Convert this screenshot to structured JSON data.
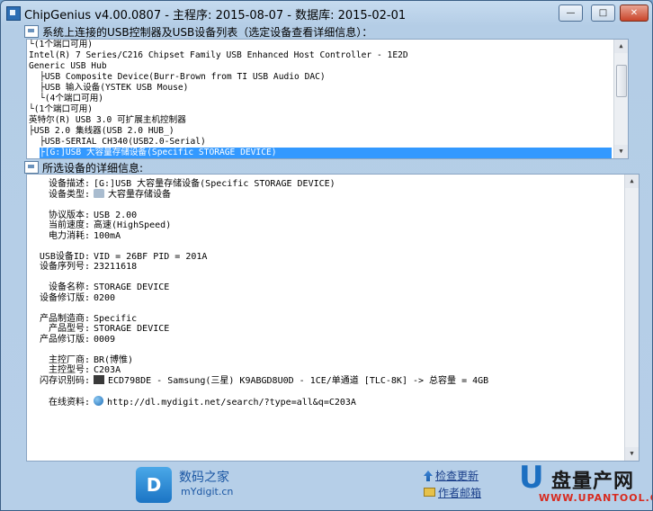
{
  "window": {
    "title": "ChipGenius v4.00.0807 - 主程序: 2015-08-07 - 数据库: 2015-02-01",
    "min": "—",
    "max": "□",
    "close": "✕"
  },
  "device_list": {
    "label": "系统上连接的USB控制器及USB设备列表（选定设备查看详细信息）：",
    "items": [
      {
        "text": "└(1个端口可用)",
        "indent": 0,
        "selected": false
      },
      {
        "text": "Intel(R) 7 Series/C216 Chipset Family USB Enhanced Host Controller - 1E2D",
        "indent": 0,
        "selected": false
      },
      {
        "text": "  Generic USB Hub",
        "indent": 0,
        "selected": false
      },
      {
        "text": "├USB Composite Device(Burr-Brown from TI USB Audio DAC)",
        "indent": 2,
        "selected": false
      },
      {
        "text": "├USB 输入设备(YSTEK USB Mouse)",
        "indent": 2,
        "selected": false
      },
      {
        "text": "└(4个端口可用)",
        "indent": 2,
        "selected": false
      },
      {
        "text": "└(1个端口可用)",
        "indent": 0,
        "selected": false
      },
      {
        "text": "英特尔(R) USB 3.0 可扩展主机控制器",
        "indent": 0,
        "selected": false
      },
      {
        "text": "├USB 2.0 集线器(USB 2.0 HUB_)",
        "indent": 0,
        "selected": false
      },
      {
        "text": "├USB-SERIAL CH340(USB2.0-Serial)",
        "indent": 2,
        "selected": false
      },
      {
        "text": "├[G:]USB 大容量存储设备(Specific STORAGE DEVICE)",
        "indent": 2,
        "selected": true
      }
    ]
  },
  "details": {
    "label": "所选设备的详细信息:",
    "rows": [
      {
        "key": "设备描述:",
        "value": "[G:]USB 大容量存储设备(Specific STORAGE DEVICE)",
        "icon": ""
      },
      {
        "key": "设备类型:",
        "value": "大容量存储设备",
        "icon": "usb"
      },
      {
        "key": "",
        "value": "",
        "icon": ""
      },
      {
        "key": "协议版本:",
        "value": "USB 2.00",
        "icon": ""
      },
      {
        "key": "当前速度:",
        "value": "高速(HighSpeed)",
        "icon": ""
      },
      {
        "key": "电力消耗:",
        "value": "100mA",
        "icon": ""
      },
      {
        "key": "",
        "value": "",
        "icon": ""
      },
      {
        "key": "USB设备ID:",
        "value": "VID = 26BF PID = 201A",
        "icon": ""
      },
      {
        "key": "设备序列号:",
        "value": "23211618",
        "icon": ""
      },
      {
        "key": "",
        "value": "",
        "icon": ""
      },
      {
        "key": "设备名称:",
        "value": "STORAGE DEVICE",
        "icon": ""
      },
      {
        "key": "设备修订版:",
        "value": "0200",
        "icon": ""
      },
      {
        "key": "",
        "value": "",
        "icon": ""
      },
      {
        "key": "产品制造商:",
        "value": "Specific",
        "icon": ""
      },
      {
        "key": "产品型号:",
        "value": "STORAGE DEVICE",
        "icon": ""
      },
      {
        "key": "产品修订版:",
        "value": "0009",
        "icon": ""
      },
      {
        "key": "",
        "value": "",
        "icon": ""
      },
      {
        "key": "主控厂商:",
        "value": "BR(博惟)",
        "icon": ""
      },
      {
        "key": "主控型号:",
        "value": "C203A",
        "icon": ""
      },
      {
        "key": "闪存识别码:",
        "value": "ECD798DE - Samsung(三星) K9ABGD8U0D - 1CE/单通道 [TLC-8K] -> 总容量 = 4GB",
        "icon": "chip"
      },
      {
        "key": "",
        "value": "",
        "icon": ""
      },
      {
        "key": "在线资料:",
        "value": "http://dl.mydigit.net/search/?type=all&q=C203A",
        "icon": "globe"
      }
    ]
  },
  "footer": {
    "brand_cn": "数码之家",
    "brand_en": "mYdigit.cn",
    "check_update": "检查更新",
    "author_email": "作者邮箱",
    "watermark_u": "U",
    "watermark_cn": "盘量产网",
    "watermark_en": "WWW.UPANTOOL.COM"
  }
}
